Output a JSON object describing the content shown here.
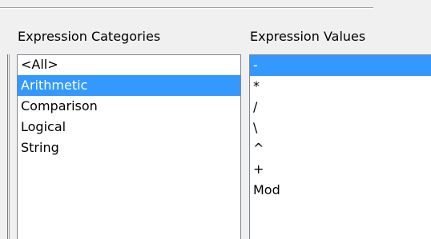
{
  "categories": {
    "label": "Expression Categories",
    "items": [
      "<All>",
      "Arithmetic",
      "Comparison",
      "Logical",
      "String"
    ],
    "selected_index": 1
  },
  "values": {
    "label": "Expression Values",
    "items": [
      "-",
      "*",
      "/",
      "\\",
      "^",
      "+",
      "Mod"
    ],
    "selected_index": 0
  },
  "colors": {
    "selection": "#3399ff",
    "window_bg": "#f0f0f0"
  }
}
